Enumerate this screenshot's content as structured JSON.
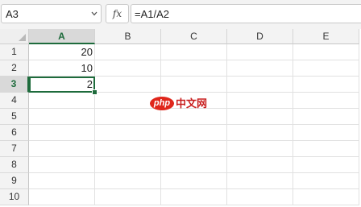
{
  "formula_bar": {
    "name_box": "A3",
    "fx_label": "fx",
    "formula": "=A1/A2"
  },
  "columns": [
    "A",
    "B",
    "C",
    "D",
    "E"
  ],
  "rows": [
    "1",
    "2",
    "3",
    "4",
    "5",
    "6",
    "7",
    "8",
    "9",
    "10"
  ],
  "active_column": "A",
  "active_row": "3",
  "cells": {
    "A1": "20",
    "A2": "10",
    "A3": "2"
  },
  "colors": {
    "selection": "#1e6b3c",
    "watermark_red": "#e0261b"
  },
  "watermark": {
    "logo_text": "php",
    "text": "中文网"
  }
}
